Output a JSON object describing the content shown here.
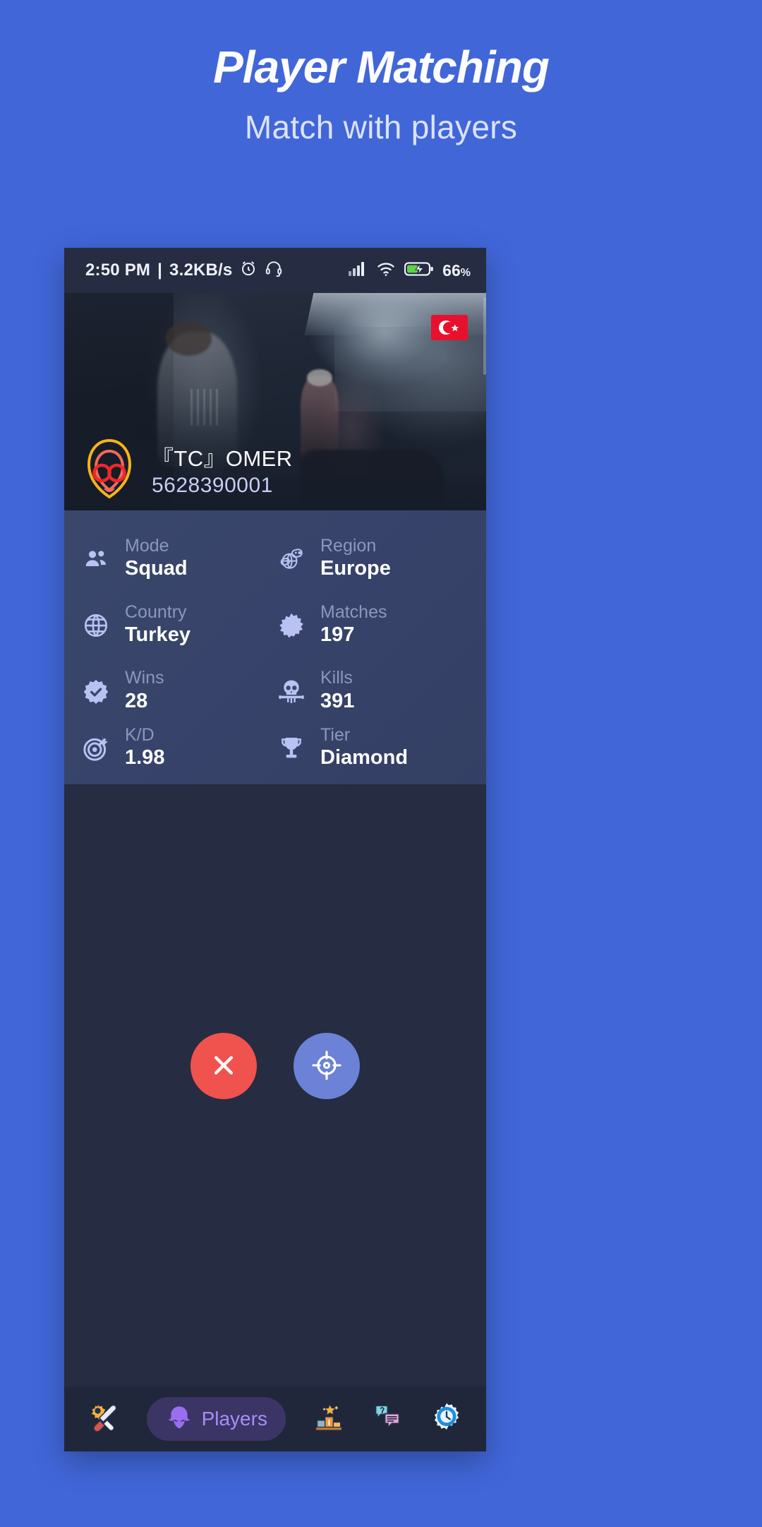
{
  "promo": {
    "title": "Player Matching",
    "subtitle": "Match with players",
    "background_color": "#4166d8"
  },
  "status_bar": {
    "time": "2:50 PM",
    "separator": "|",
    "net_speed": "3.2KB/s",
    "alarm_icon": "alarm-clock-icon",
    "headset_icon": "headset-icon",
    "signal_icon": "cellular-signal-icon",
    "wifi_icon": "wifi-icon",
    "battery_icon": "battery-charging-icon",
    "battery_percent": "66",
    "percent_symbol": "%"
  },
  "banner": {
    "alt": "game-screenshot-indoor-warehouse-two-soldiers"
  },
  "player": {
    "avatar_icon": "neon-alien-face-avatar",
    "name": "『TC』OMER",
    "id": "5628390001",
    "flag": "turkey-flag",
    "flag_color": "#e8112d"
  },
  "stats": [
    {
      "label": "Mode",
      "value": "Squad",
      "icon": "people-group-icon"
    },
    {
      "label": "Region",
      "value": "Europe",
      "icon": "globe-gamepad-icon"
    },
    {
      "label": "Country",
      "value": "Turkey",
      "icon": "globe-icon"
    },
    {
      "label": "Matches",
      "value": "197",
      "icon": "starburst-icon"
    },
    {
      "label": "Wins",
      "value": "28",
      "icon": "badge-check-icon"
    },
    {
      "label": "Kills",
      "value": "391",
      "icon": "skull-gun-icon"
    },
    {
      "label": "K/D",
      "value": "1.98",
      "icon": "target-arrow-icon"
    },
    {
      "label": "Tier",
      "value": "Diamond",
      "icon": "trophy-icon"
    }
  ],
  "actions": {
    "cancel_icon": "close-x-icon",
    "cancel_color": "#f0524d",
    "find_icon": "crosshair-target-icon",
    "find_color": "#6b82d6"
  },
  "bottom_nav": {
    "items": [
      {
        "label": "",
        "icon": "tools-icon",
        "emoji": "🛠️",
        "active": false
      },
      {
        "label": "Players",
        "icon": "ghost-players-icon",
        "emoji": "👾",
        "active": true
      },
      {
        "label": "",
        "icon": "podium-ranking-icon",
        "emoji": "🏆",
        "active": false
      },
      {
        "label": "",
        "icon": "faq-chat-icon",
        "emoji": "💬",
        "active": false
      },
      {
        "label": "",
        "icon": "settings-gear-clock-icon",
        "emoji": "⚙️",
        "active": false
      }
    ],
    "active_pill_color": "#3b3566",
    "active_label_color": "#a98df5"
  }
}
